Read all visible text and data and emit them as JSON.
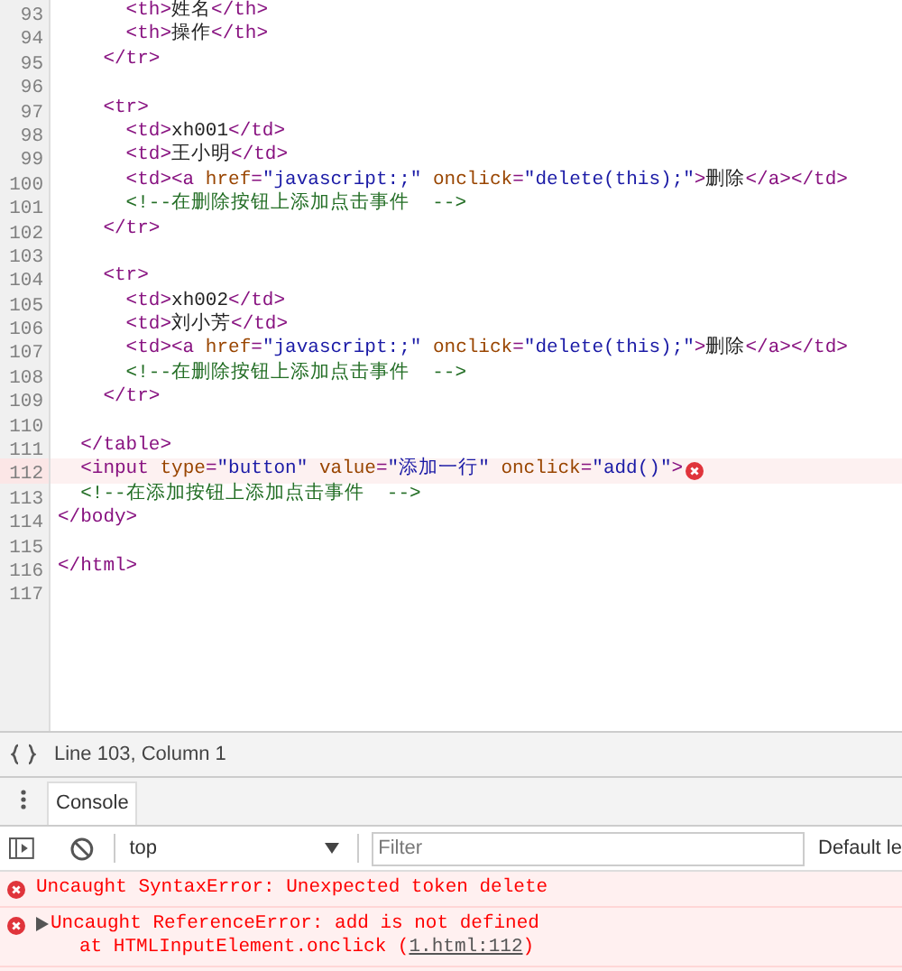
{
  "editor": {
    "lines": [
      {
        "number": "93",
        "error": false,
        "tokens": [
          {
            "kind": "tag",
            "text": "      <th>"
          },
          {
            "kind": "text",
            "text": "姓名"
          },
          {
            "kind": "tag",
            "text": "</th>"
          }
        ]
      },
      {
        "number": "94",
        "error": false,
        "tokens": [
          {
            "kind": "tag",
            "text": "      <th>"
          },
          {
            "kind": "text",
            "text": "操作"
          },
          {
            "kind": "tag",
            "text": "</th>"
          }
        ]
      },
      {
        "number": "95",
        "error": false,
        "tokens": [
          {
            "kind": "tag",
            "text": "    </tr>"
          }
        ]
      },
      {
        "number": "96",
        "error": false
      },
      {
        "number": "97",
        "error": false,
        "tokens": [
          {
            "kind": "tag",
            "text": "    <tr>"
          }
        ]
      },
      {
        "number": "98",
        "error": false,
        "tokens": [
          {
            "kind": "tag",
            "text": "      <td>"
          },
          {
            "kind": "text",
            "text": "xh001"
          },
          {
            "kind": "tag",
            "text": "</td>"
          }
        ]
      },
      {
        "number": "99",
        "error": false,
        "tokens": [
          {
            "kind": "tag",
            "text": "      <td>"
          },
          {
            "kind": "text",
            "text": "王小明"
          },
          {
            "kind": "tag",
            "text": "</td>"
          }
        ]
      },
      {
        "number": "100",
        "error": false,
        "tokens": [
          {
            "kind": "tag",
            "text": "      <td><a "
          },
          {
            "kind": "attr",
            "text": "href"
          },
          {
            "kind": "tag",
            "text": "="
          },
          {
            "kind": "string",
            "text": "\"javascript:;\""
          },
          {
            "kind": "attr",
            "text": " onclick"
          },
          {
            "kind": "tag",
            "text": "="
          },
          {
            "kind": "string",
            "text": "\"delete(this);\""
          },
          {
            "kind": "tag",
            "text": ">"
          },
          {
            "kind": "text",
            "text": "删除"
          },
          {
            "kind": "tag",
            "text": "</a></td>"
          }
        ]
      },
      {
        "number": "101",
        "error": false,
        "tokens": [
          {
            "kind": "comment",
            "text": "      <!--在删除按钮上添加点击事件  -->"
          }
        ]
      },
      {
        "number": "102",
        "error": false,
        "tokens": [
          {
            "kind": "tag",
            "text": "    </tr>"
          }
        ]
      },
      {
        "number": "103",
        "error": false
      },
      {
        "number": "104",
        "error": false,
        "tokens": [
          {
            "kind": "tag",
            "text": "    <tr>"
          }
        ]
      },
      {
        "number": "105",
        "error": false,
        "tokens": [
          {
            "kind": "tag",
            "text": "      <td>"
          },
          {
            "kind": "text",
            "text": "xh002"
          },
          {
            "kind": "tag",
            "text": "</td>"
          }
        ]
      },
      {
        "number": "106",
        "error": false,
        "tokens": [
          {
            "kind": "tag",
            "text": "      <td>"
          },
          {
            "kind": "text",
            "text": "刘小芳"
          },
          {
            "kind": "tag",
            "text": "</td>"
          }
        ]
      },
      {
        "number": "107",
        "error": false,
        "tokens": [
          {
            "kind": "tag",
            "text": "      <td><a "
          },
          {
            "kind": "attr",
            "text": "href"
          },
          {
            "kind": "tag",
            "text": "="
          },
          {
            "kind": "string",
            "text": "\"javascript:;\""
          },
          {
            "kind": "attr",
            "text": " onclick"
          },
          {
            "kind": "tag",
            "text": "="
          },
          {
            "kind": "string",
            "text": "\"delete(this);\""
          },
          {
            "kind": "tag",
            "text": ">"
          },
          {
            "kind": "text",
            "text": "删除"
          },
          {
            "kind": "tag",
            "text": "</a></td>"
          }
        ]
      },
      {
        "number": "108",
        "error": false,
        "tokens": [
          {
            "kind": "comment",
            "text": "      <!--在删除按钮上添加点击事件  -->"
          }
        ]
      },
      {
        "number": "109",
        "error": false,
        "tokens": [
          {
            "kind": "tag",
            "text": "    </tr>"
          }
        ]
      },
      {
        "number": "110",
        "error": false
      },
      {
        "number": "111",
        "error": false,
        "tokens": [
          {
            "kind": "tag",
            "text": "  </table>"
          }
        ]
      },
      {
        "number": "112",
        "error": true,
        "tokens": [
          {
            "kind": "tag",
            "text": "  <input "
          },
          {
            "kind": "attr",
            "text": "type"
          },
          {
            "kind": "tag",
            "text": "="
          },
          {
            "kind": "string",
            "text": "\"button\""
          },
          {
            "kind": "attr",
            "text": " value"
          },
          {
            "kind": "tag",
            "text": "="
          },
          {
            "kind": "string",
            "text": "\"添加一行\""
          },
          {
            "kind": "attr",
            "text": " onclick"
          },
          {
            "kind": "tag",
            "text": "="
          },
          {
            "kind": "string",
            "text": "\"add()\""
          },
          {
            "kind": "tag",
            "text": ">"
          }
        ]
      },
      {
        "number": "113",
        "error": false,
        "tokens": [
          {
            "kind": "comment",
            "text": "  <!--在添加按钮上添加点击事件  -->"
          }
        ]
      },
      {
        "number": "114",
        "error": false,
        "tokens": [
          {
            "kind": "tag",
            "text": "</body>"
          }
        ]
      },
      {
        "number": "115",
        "error": false
      },
      {
        "number": "116",
        "error": false,
        "tokens": [
          {
            "kind": "tag",
            "text": "</html>"
          }
        ]
      },
      {
        "number": "117",
        "error": false
      }
    ]
  },
  "status_bar": {
    "position": "Line 103, Column 1"
  },
  "drawer": {
    "tabs": [
      {
        "label": "Console",
        "selected": true
      }
    ]
  },
  "console": {
    "context": "top",
    "filter": {
      "placeholder": "Filter"
    },
    "levels": "Default le",
    "messages": [
      {
        "kind": "error",
        "expandable": false,
        "text": "Uncaught SyntaxError: Unexpected token delete"
      },
      {
        "kind": "error",
        "expandable": true,
        "text": "Uncaught ReferenceError: add is not defined",
        "stack": "at HTMLInputElement.onclick (",
        "link": "1.html:112",
        "stack_end": ")"
      }
    ]
  }
}
